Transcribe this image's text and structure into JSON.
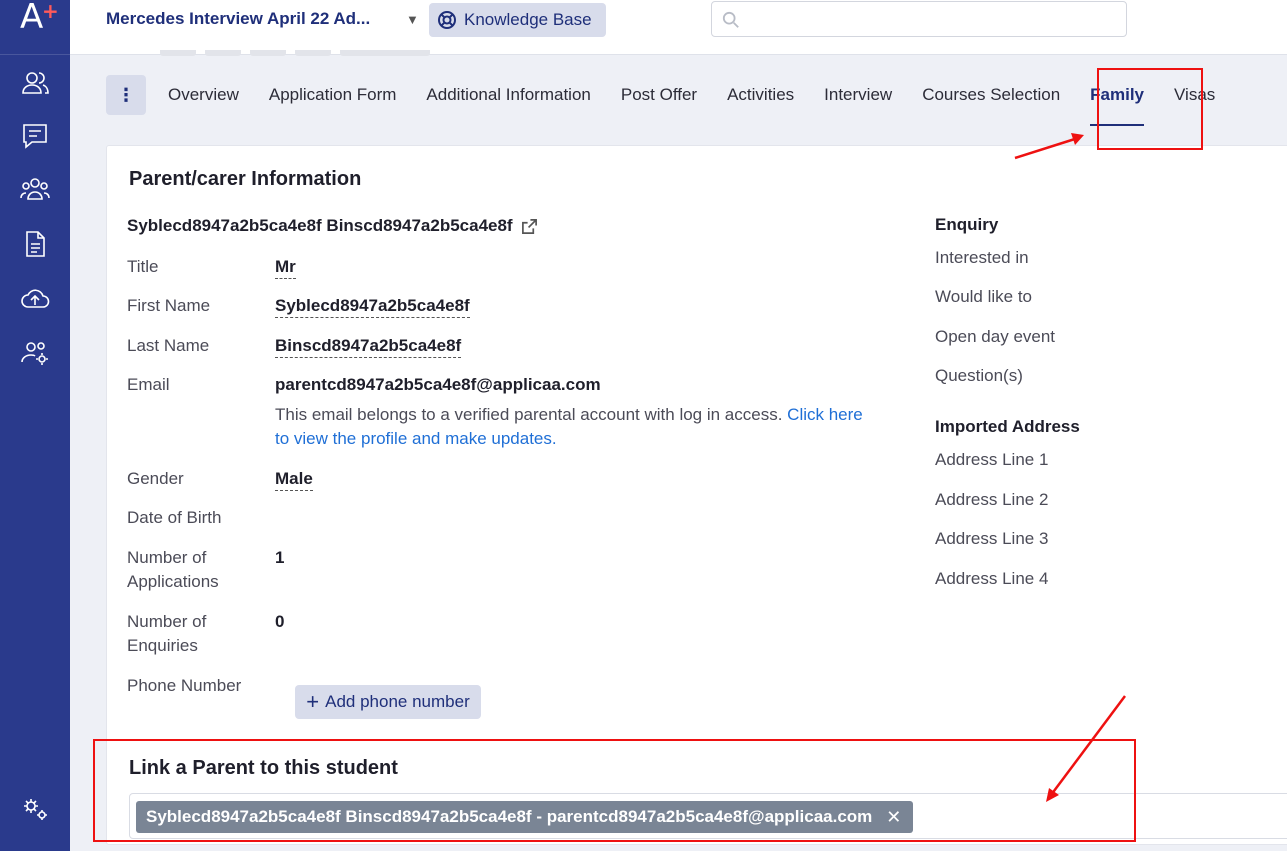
{
  "brand": {
    "logo_letter": "A",
    "logo_plus": "+"
  },
  "sidebar": {
    "icons": [
      "contacts-icon",
      "messages-icon",
      "groups-icon",
      "document-icon",
      "cloud-upload-icon",
      "user-settings-icon"
    ],
    "bottom_icon": "settings-icon"
  },
  "header": {
    "title": "Mercedes Interview April 22 Ad...",
    "knowledge_base_label": "Knowledge Base",
    "search_placeholder": ""
  },
  "tabs": [
    {
      "label": "Overview",
      "active": false
    },
    {
      "label": "Application Form",
      "active": false
    },
    {
      "label": "Additional Information",
      "active": false
    },
    {
      "label": "Post Offer",
      "active": false
    },
    {
      "label": "Activities",
      "active": false
    },
    {
      "label": "Interview",
      "active": false
    },
    {
      "label": "Courses Selection",
      "active": false
    },
    {
      "label": "Family",
      "active": true
    },
    {
      "label": "Visas",
      "active": false
    }
  ],
  "parent": {
    "section_title": "Parent/carer Information",
    "full_name": "Syblecd8947a2b5ca4e8f Binscd8947a2b5ca4e8f",
    "fields": {
      "title": {
        "label": "Title",
        "value": "Mr"
      },
      "first_name": {
        "label": "First Name",
        "value": "Syblecd8947a2b5ca4e8f"
      },
      "last_name": {
        "label": "Last Name",
        "value": "Binscd8947a2b5ca4e8f"
      },
      "email": {
        "label": "Email",
        "value": "parentcd8947a2b5ca4e8f@applicaa.com"
      },
      "gender": {
        "label": "Gender",
        "value": "Male"
      },
      "dob": {
        "label": "Date of Birth",
        "value": ""
      },
      "num_apps": {
        "label_1": "Number of",
        "label_2": "Applications",
        "value": "1"
      },
      "num_enq": {
        "label_1": "Number of",
        "label_2": "Enquiries",
        "value": "0"
      },
      "phone": {
        "label": "Phone Number",
        "button": "Add phone number"
      }
    },
    "email_note": "This email belongs to a verified parental account with log in access. ",
    "email_link_1": "Click here",
    "email_link_2": "to view the profile and make updates."
  },
  "enquiry": {
    "heading": "Enquiry",
    "items": [
      "Interested in",
      "Would like to",
      "Open day event",
      "Question(s)"
    ]
  },
  "address": {
    "heading": "Imported Address",
    "items": [
      "Address Line 1",
      "Address Line 2",
      "Address Line 3",
      "Address Line 4"
    ]
  },
  "link_parent": {
    "title": "Link a Parent to this student",
    "chip_label": "Syblecd8947a2b5ca4e8f Binscd8947a2b5ca4e8f - parentcd8947a2b5ca4e8f@applicaa.com",
    "chip_remove": "✕"
  },
  "colors": {
    "sidebar": "#2a3a8c",
    "accent": "#1f2f7a",
    "annotation": "#e11111",
    "link": "#1f6fd6"
  }
}
